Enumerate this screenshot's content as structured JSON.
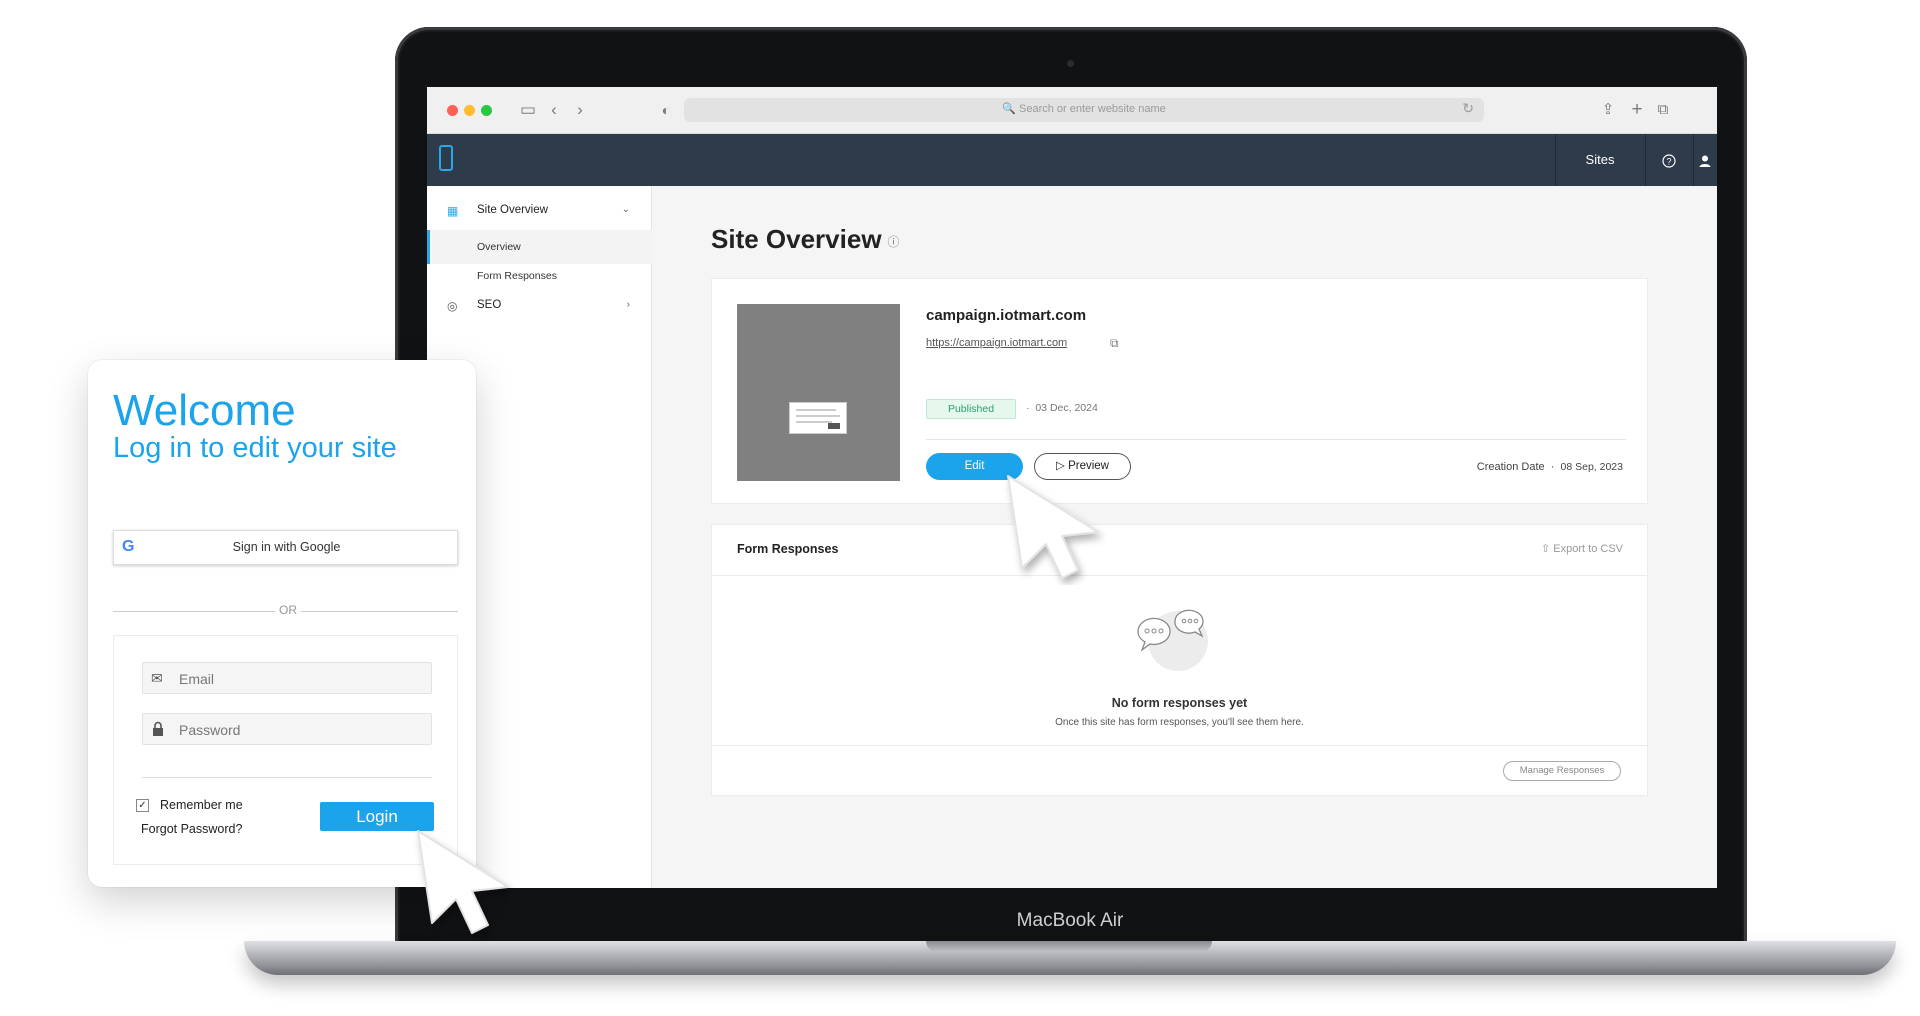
{
  "device": {
    "label": "MacBook Air"
  },
  "browser": {
    "url_placeholder": "Search or enter website name",
    "icons": [
      "sidebar-icon",
      "back-icon",
      "forward-icon",
      "shield-icon",
      "reload-icon",
      "share-icon",
      "new-tab-icon",
      "tabs-icon"
    ]
  },
  "header": {
    "sites_label": "Sites",
    "help_icon": "?",
    "user_icon": "user"
  },
  "sidebar": {
    "site_overview": "Site Overview",
    "items": [
      {
        "label": "Overview",
        "active": true
      },
      {
        "label": "Form Responses",
        "active": false
      }
    ],
    "seo": "SEO"
  },
  "main": {
    "title": "Site Overview",
    "site": {
      "domain": "campaign.iotmart.com",
      "url": "https://campaign.iotmart.com",
      "status": "Published",
      "published_date": "03 Dec, 2024",
      "edit_label": "Edit",
      "preview_label": "Preview",
      "creation_label": "Creation Date",
      "creation_date": "08 Sep, 2023"
    },
    "form_responses": {
      "title": "Form Responses",
      "export_label": "Export to CSV",
      "empty_title": "No form responses yet",
      "empty_sub": "Once this site has form responses, you'll see them here.",
      "manage_label": "Manage Responses"
    }
  },
  "login": {
    "welcome": "Welcome",
    "subtitle": "Log in to edit your site",
    "google_label": "Sign in with Google",
    "or_label": "OR",
    "email_placeholder": "Email",
    "password_placeholder": "Password",
    "remember_label": "Remember me",
    "remember_checked": true,
    "forgot_label": "Forgot Password?",
    "login_label": "Login"
  },
  "colors": {
    "accent": "#1ba3ec",
    "header": "#2e3b4a",
    "published": "#2aa06a"
  }
}
